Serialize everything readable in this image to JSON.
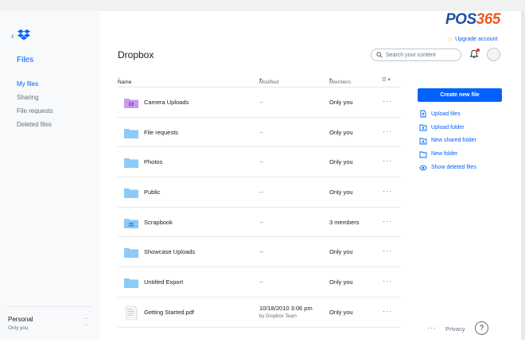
{
  "brand": {
    "pos": "POS",
    "num": "365"
  },
  "header": {
    "title": "Dropbox",
    "upgrade_label": "Upgrade account",
    "search_placeholder": "Search your content"
  },
  "sidebar": {
    "title": "Files",
    "items": [
      {
        "label": "My files",
        "active": true
      },
      {
        "label": "Sharing",
        "active": false
      },
      {
        "label": "File requests",
        "active": false
      },
      {
        "label": "Deleted files",
        "active": false
      }
    ],
    "account_name": "Personal",
    "account_sub": "Only you"
  },
  "table": {
    "headers": {
      "name": "Name",
      "modified": "Modified",
      "members": "Members"
    },
    "rows": [
      {
        "name": "Camera Uploads",
        "modified": "--",
        "modified_sub": "",
        "members": "Only you",
        "icon": "camera-folder-icon"
      },
      {
        "name": "File requests",
        "modified": "--",
        "modified_sub": "",
        "members": "Only you",
        "icon": "folder-icon"
      },
      {
        "name": "Photos",
        "modified": "--",
        "modified_sub": "",
        "members": "Only you",
        "icon": "folder-icon"
      },
      {
        "name": "Public",
        "modified": "--",
        "modified_sub": "",
        "members": "Only you",
        "icon": "folder-icon"
      },
      {
        "name": "Scrapbook",
        "modified": "--",
        "modified_sub": "",
        "members": "3 members",
        "icon": "shared-folder-icon"
      },
      {
        "name": "Showcase Uploads",
        "modified": "--",
        "modified_sub": "",
        "members": "Only you",
        "icon": "folder-icon"
      },
      {
        "name": "Untitled Export",
        "modified": "--",
        "modified_sub": "",
        "members": "Only you",
        "icon": "folder-icon"
      },
      {
        "name": "Getting Started.pdf",
        "modified": "10/18/2010 3:06 pm",
        "modified_sub": "by Dropbox Team",
        "members": "Only you",
        "icon": "pdf-file-icon"
      }
    ]
  },
  "actions": {
    "create_label": "Create new file",
    "items": [
      {
        "label": "Upload files",
        "icon": "upload-files-icon"
      },
      {
        "label": "Upload folder",
        "icon": "upload-folder-icon"
      },
      {
        "label": "New shared folder",
        "icon": "new-shared-folder-icon"
      },
      {
        "label": "New folder",
        "icon": "new-folder-icon"
      },
      {
        "label": "Show deleted files",
        "icon": "eye-icon"
      }
    ]
  },
  "footer": {
    "privacy_label": "Privacy",
    "help_label": "?"
  },
  "colors": {
    "accent": "#0061fe",
    "folder": "#8ccaf7",
    "camera_folder": "#c89af0"
  }
}
